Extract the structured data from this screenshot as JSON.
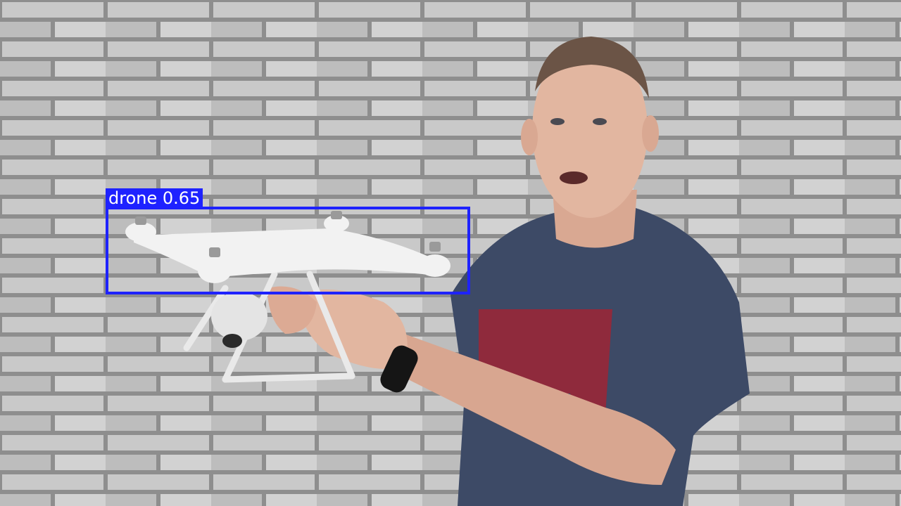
{
  "detection": {
    "label": "drone 0.65",
    "class": "drone",
    "confidence": 0.65,
    "box_color": "#1e22ff",
    "label_text_color": "#ffffff"
  },
  "scene": {
    "wall_color": "#c8c8c8",
    "mortar_color": "#8e8e8e",
    "shirt_color": "#3d4a66",
    "shirt_print_color": "#8f2a3c",
    "skin_color": "#e2b6a0",
    "drone_color": "#f2f2f2"
  }
}
